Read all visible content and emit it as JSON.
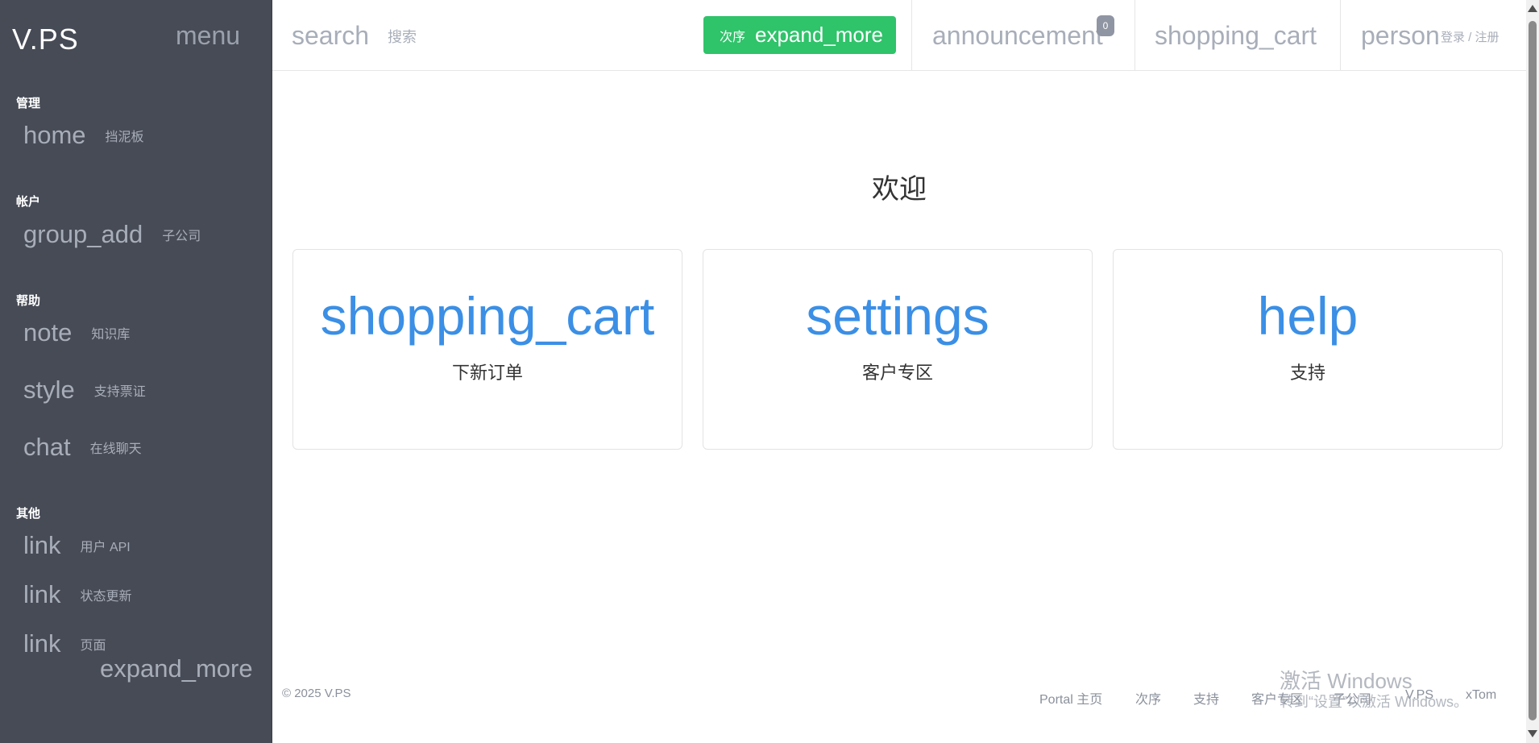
{
  "sidebar": {
    "brand": "V.PS",
    "menu_icon": "menu",
    "sections": [
      {
        "title": "管理"
      },
      {
        "title": "帐户"
      },
      {
        "title": "帮助"
      },
      {
        "title": "其他"
      }
    ],
    "items": [
      {
        "icon": "home",
        "label": "挡泥板"
      },
      {
        "icon": "group_add",
        "label": "子公司"
      },
      {
        "icon": "note",
        "label": "知识库"
      },
      {
        "icon": "style",
        "label": "支持票证"
      },
      {
        "icon": "chat",
        "label": "在线聊天"
      },
      {
        "icon": "link",
        "label": "用户 API"
      },
      {
        "icon": "link",
        "label": "状态更新"
      },
      {
        "icon": "link",
        "label": "页面"
      }
    ],
    "expand_icon": "expand_more"
  },
  "topbar": {
    "search_icon": "search",
    "search_label": "搜索",
    "order_label": "次序",
    "order_icon": "expand_more",
    "announcement_icon": "announcement",
    "announcement_count": "0",
    "cart_icon": "shopping_cart",
    "person_icon": "person",
    "login_label": "登录 / 注册"
  },
  "main": {
    "welcome": "欢迎",
    "cards": [
      {
        "icon": "shopping_cart",
        "label": "下新订单"
      },
      {
        "icon": "settings",
        "label": "客户专区"
      },
      {
        "icon": "help",
        "label": "支持"
      }
    ]
  },
  "footer": {
    "copyright": "© 2025 V.PS",
    "links": [
      "Portal 主页",
      "次序",
      "支持",
      "客户专区",
      "子公司",
      "V.PS",
      "xTom"
    ]
  },
  "watermark": {
    "line1": "激活 Windows",
    "line2": "转到“设置”以激活 Windows。"
  },
  "colors": {
    "sidebar_bg": "#474b56",
    "accent_green": "#2fc36a",
    "card_icon_blue": "#3b8fe5"
  }
}
